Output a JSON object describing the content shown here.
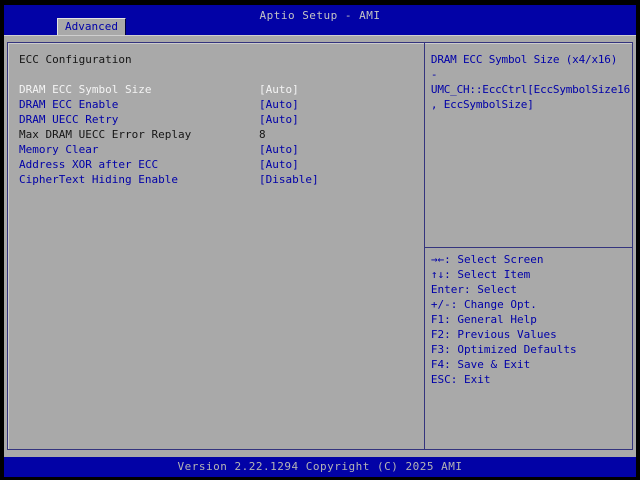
{
  "window": {
    "title": "Aptio Setup - AMI"
  },
  "tabs": [
    {
      "label": "Advanced",
      "active": true
    }
  ],
  "main": {
    "section_title": "ECC Configuration",
    "items": [
      {
        "label": "DRAM ECC Symbol Size",
        "value": "[Auto]",
        "selected": true,
        "editable": true
      },
      {
        "label": "DRAM ECC Enable",
        "value": "[Auto]",
        "selected": false,
        "editable": true
      },
      {
        "label": "DRAM UECC Retry",
        "value": "[Auto]",
        "selected": false,
        "editable": true
      },
      {
        "label": "Max DRAM UECC Error Replay",
        "value": "8",
        "selected": false,
        "editable": false
      },
      {
        "label": "Memory Clear",
        "value": "[Auto]",
        "selected": false,
        "editable": true
      },
      {
        "label": "Address XOR after ECC",
        "value": "[Auto]",
        "selected": false,
        "editable": true
      },
      {
        "label": "CipherText Hiding Enable",
        "value": "[Disable]",
        "selected": false,
        "editable": true
      }
    ]
  },
  "help": {
    "lines": [
      "DRAM ECC Symbol Size (x4/x16)",
      "-",
      "UMC_CH::EccCtrl[EccSymbolSize16",
      ", EccSymbolSize]"
    ]
  },
  "keys": [
    {
      "key": "→←",
      "action": "Select Screen"
    },
    {
      "key": "↑↓",
      "action": "Select Item"
    },
    {
      "key": "Enter",
      "action": "Select"
    },
    {
      "key": "+/-",
      "action": "Change Opt."
    },
    {
      "key": "F1",
      "action": "General Help"
    },
    {
      "key": "F2",
      "action": "Previous Values"
    },
    {
      "key": "F3",
      "action": "Optimized Defaults"
    },
    {
      "key": "F4",
      "action": "Save & Exit"
    },
    {
      "key": "ESC",
      "action": "Exit"
    }
  ],
  "footer": {
    "version": "Version 2.22.1294 Copyright (C) 2025 AMI"
  },
  "colors": {
    "header_bg": "#0202a6",
    "body_bg": "#a9a9a9",
    "item_blue": "#0000a8",
    "selected_text": "#f4f4f4",
    "readonly_text": "#161616",
    "panel_border": "#34347e",
    "muted_text_on_blue": "#b4b4b4"
  }
}
